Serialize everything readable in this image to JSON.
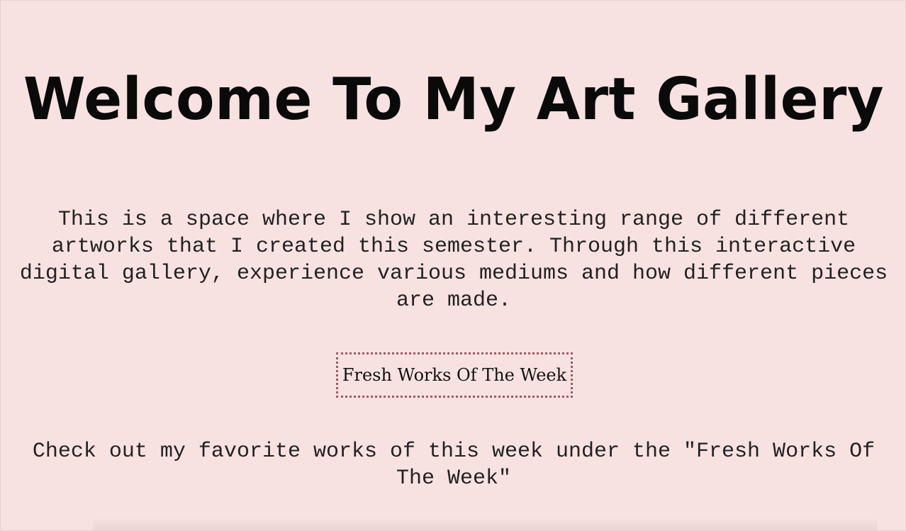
{
  "header": {
    "title": "Welcome To My Art Gallery"
  },
  "main": {
    "intro_text": "This is a space where I show an interesting range of different artworks that I created this semester. Through this interactive digital gallery, experience various mediums and how different pieces are made.",
    "fresh_works_button_label": "Fresh Works Of The Week",
    "outro_text": "Check out my favorite works of this week under the \"Fresh Works Of The Week\""
  },
  "colors": {
    "background": "#f8e2e1",
    "text": "#222222",
    "title": "#0a0a0a",
    "button_border": "#a05a5e"
  }
}
